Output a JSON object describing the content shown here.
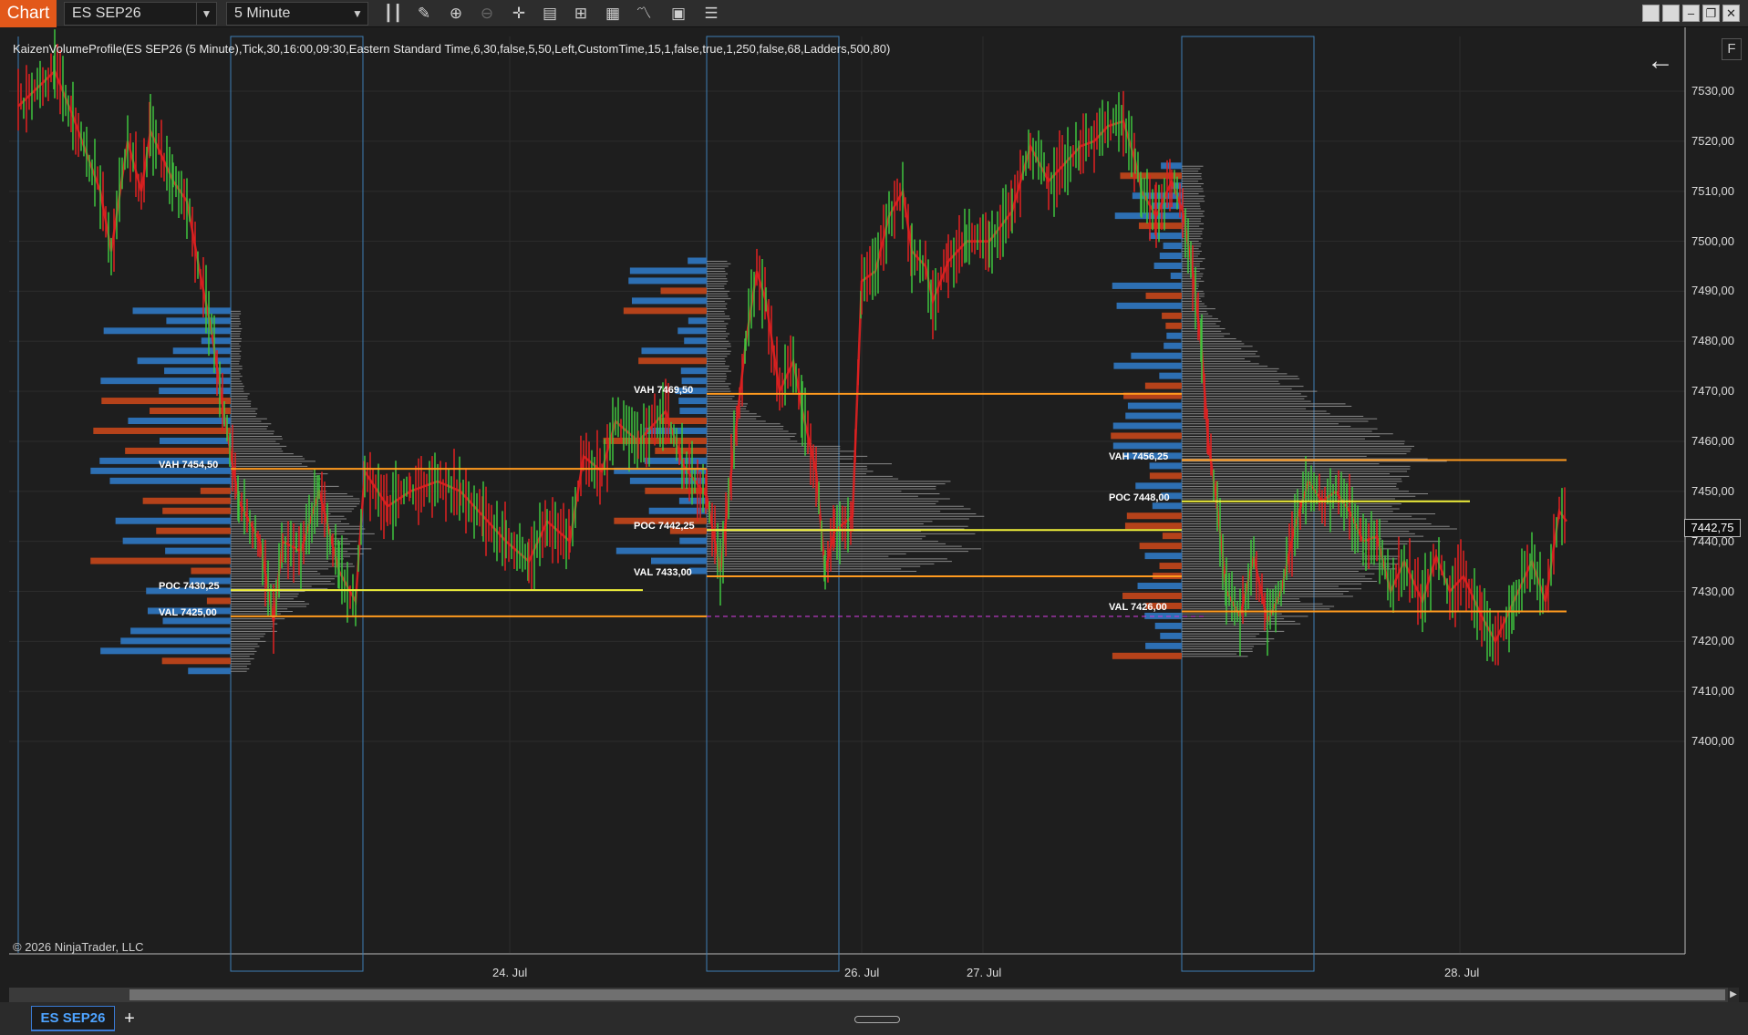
{
  "window": {
    "chart_tab": "Chart",
    "instrument": "ES SEP26",
    "interval": "5 Minute",
    "bottom_tab": "ES SEP26",
    "add_tab": "+"
  },
  "toolbar_icons": [
    "bar-type-icon",
    "pencil-draw-icon",
    "zoom-in-icon",
    "zoom-out-icon",
    "crosshair-icon",
    "data-box-icon",
    "templates-icon",
    "strategies-icon",
    "indicators-icon",
    "properties-icon",
    "instrument-list-icon"
  ],
  "indicator_label": "KaizenVolumeProfile(ES SEP26 (5 Minute),Tick,30,16:00,09:30,Eastern Standard Time,6,30,false,5,50,Left,CustomTime,15,1,false,true,1,250,false,68,Ladders,500,80)",
  "copyright": "© 2026 NinjaTrader, LLC",
  "f_button": "F",
  "current_price": "7442,75",
  "price_axis": [
    "7530,00",
    "7520,00",
    "7510,00",
    "7500,00",
    "7490,00",
    "7480,00",
    "7470,00",
    "7460,00",
    "7450,00",
    "7440,00",
    "7430,00",
    "7420,00",
    "7410,00",
    "7400,00"
  ],
  "date_axis": [
    "24. Jul",
    "26. Jul",
    "27. Jul",
    "28. Jul"
  ],
  "levels": [
    {
      "label": "VAH 7454,50",
      "price": 7454.5,
      "kind": "vah"
    },
    {
      "label": "POC 7430,25",
      "price": 7430.25,
      "kind": "poc"
    },
    {
      "label": "VAL 7425,00",
      "price": 7425.0,
      "kind": "val"
    },
    {
      "label": "VAH 7469,50",
      "price": 7469.5,
      "kind": "vah"
    },
    {
      "label": "POC 7442,25",
      "price": 7442.25,
      "kind": "poc"
    },
    {
      "label": "VAL 7433,00",
      "price": 7433.0,
      "kind": "val"
    },
    {
      "label": "VAH 7456,25",
      "price": 7456.25,
      "kind": "vah"
    },
    {
      "label": "POC 7448,00",
      "price": 7448.0,
      "kind": "poc"
    },
    {
      "label": "VAL 7426,00",
      "price": 7426.0,
      "kind": "val"
    }
  ],
  "colors": {
    "background": "#1e1e1e",
    "up_candle": "#3fc43f",
    "down_candle": "#e02020",
    "vah_val": "#ff9a1f",
    "poc": "#f0f03a",
    "profile_gray": "#9a9a9a",
    "profile_blue": "#2d6fb3",
    "profile_orange": "#b5421a",
    "session_box": "#3d7fb5",
    "grid": "#2c2c2c"
  }
}
